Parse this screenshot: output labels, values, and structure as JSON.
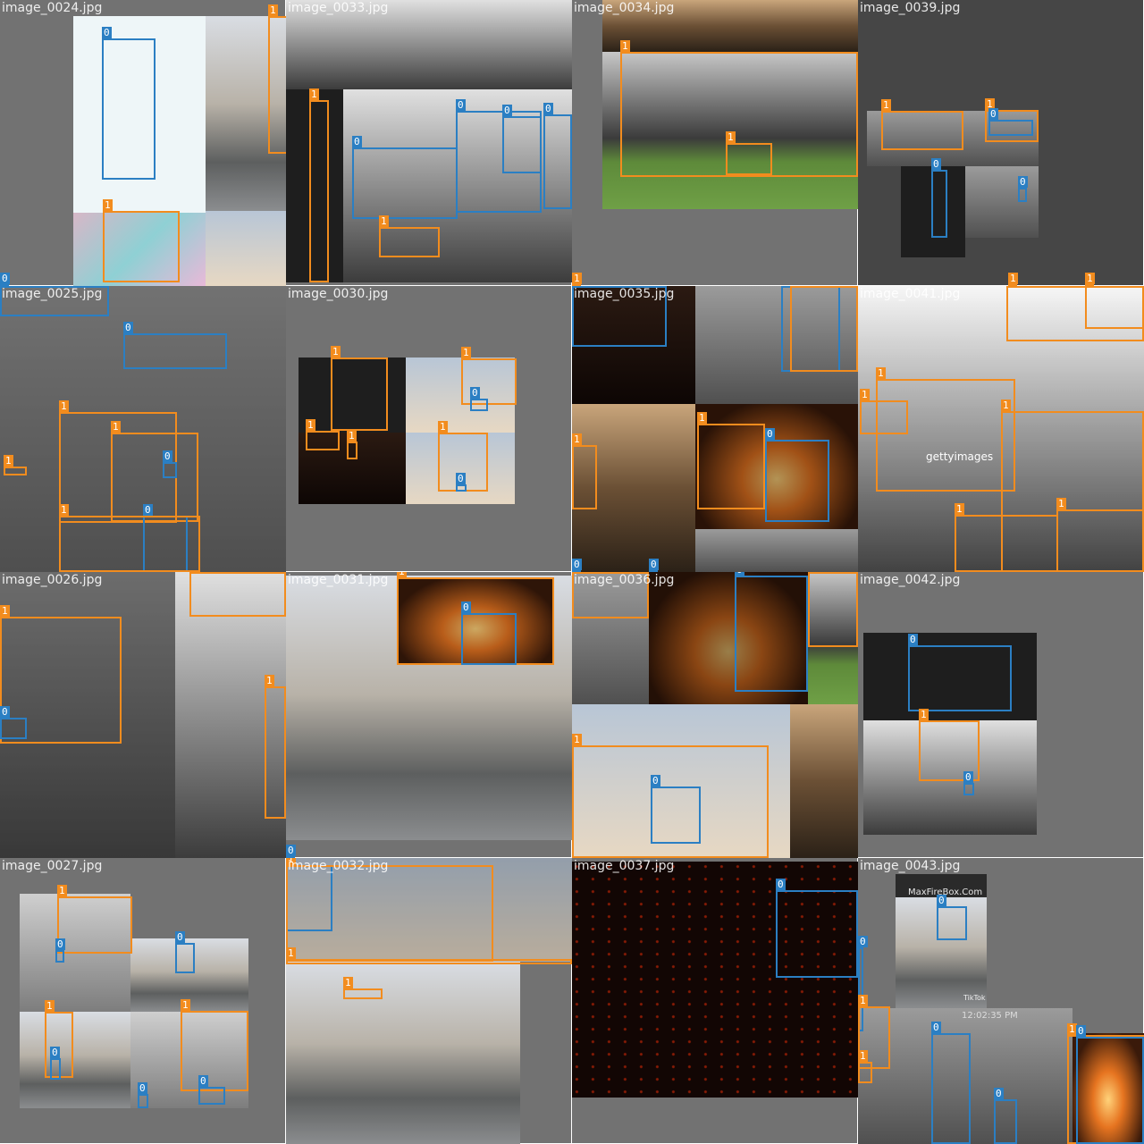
{
  "tiles": [
    {
      "label": "image_0024.jpg"
    },
    {
      "label": "image_0033.jpg"
    },
    {
      "label": "image_0034.jpg"
    },
    {
      "label": "image_0039.jpg"
    },
    {
      "label": "image_0025.jpg"
    },
    {
      "label": "image_0030.jpg"
    },
    {
      "label": "image_0035.jpg"
    },
    {
      "label": "image_0041.jpg"
    },
    {
      "label": "image_0026.jpg"
    },
    {
      "label": "image_0031.jpg"
    },
    {
      "label": "image_0036.jpg"
    },
    {
      "label": "image_0042.jpg"
    },
    {
      "label": "image_0027.jpg"
    },
    {
      "label": "image_0032.jpg"
    },
    {
      "label": "image_0037.jpg"
    },
    {
      "label": "image_0043.jpg"
    }
  ],
  "class_labels": {
    "c0": "0",
    "c1": "1"
  },
  "overlay_text": {
    "getty": "gettyimages",
    "maxfire": "MaxFireBox.Com",
    "tiktok": "TikTok",
    "timestamp": "12:02:35 PM"
  },
  "colors": {
    "class_0": "#2b7fc3",
    "class_1": "#f28c1e",
    "tile_background": "#727272",
    "label_text": "#ffffff"
  }
}
